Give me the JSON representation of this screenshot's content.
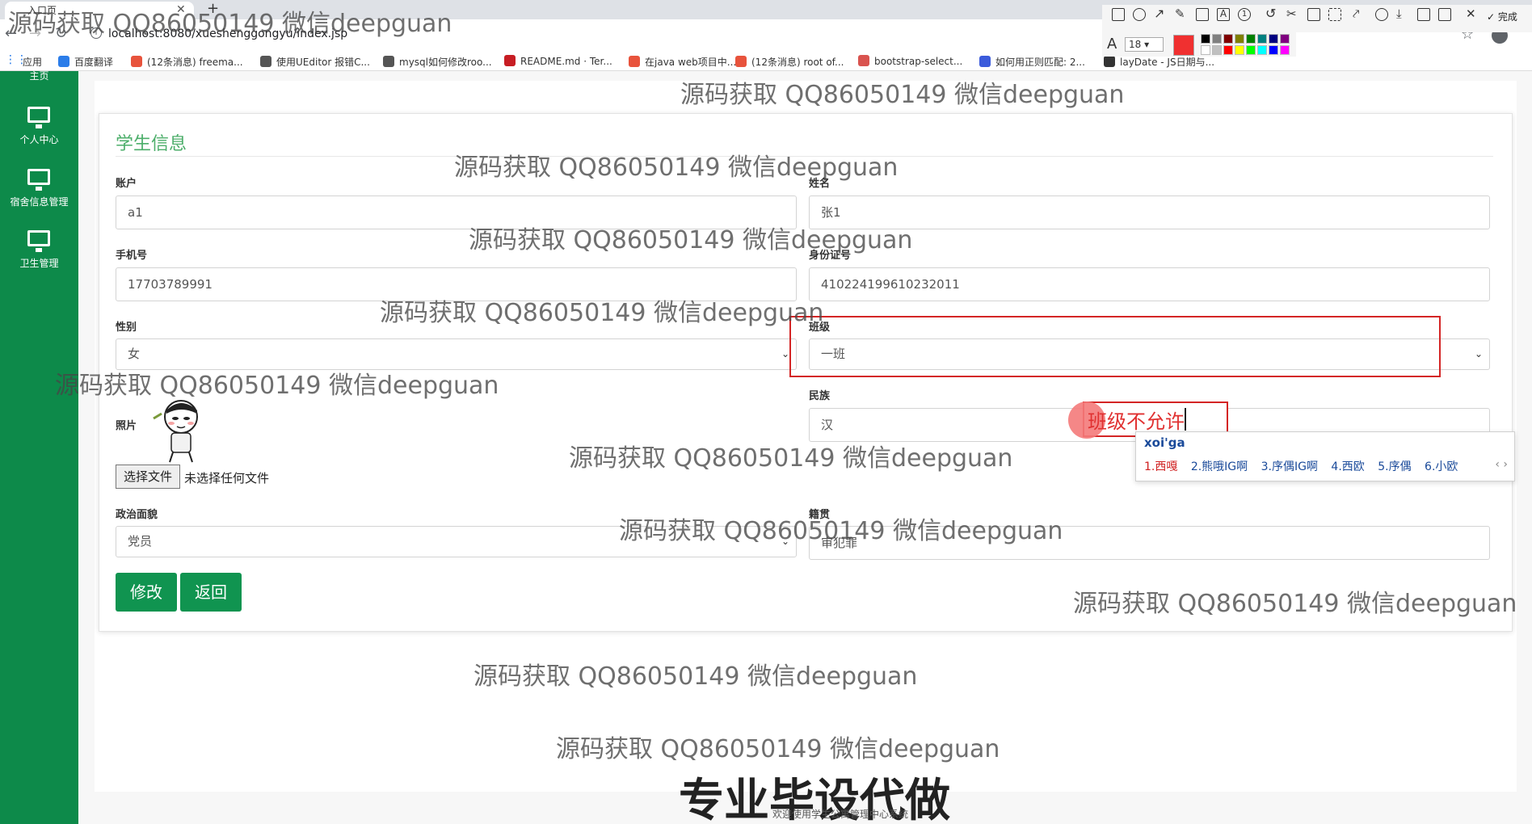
{
  "browser": {
    "tab_title": "入口页",
    "url": "localhost:8080/xueshenggongyu/index.jsp",
    "apps_label": "应用",
    "bookmarks": [
      {
        "label": "百度翻译",
        "color": "#2b7de9"
      },
      {
        "label": "(12条消息) freema...",
        "color": "#e8533c"
      },
      {
        "label": "使用UEditor 报错C...",
        "color": "#555555"
      },
      {
        "label": "mysql如何修改roo...",
        "color": "#555555"
      },
      {
        "label": "README.md · Ter...",
        "color": "#c71d23"
      },
      {
        "label": "在java web项目中...",
        "color": "#e8533c"
      },
      {
        "label": "(12条消息) root of...",
        "color": "#e8533c"
      },
      {
        "label": "bootstrap-select...",
        "color": "#d9534f"
      },
      {
        "label": "如何用正则匹配: 2...",
        "color": "#3b5bdb"
      },
      {
        "label": "layDate - JS日期与...",
        "color": "#333333"
      }
    ]
  },
  "snip_toolbar": {
    "font_size": "18",
    "done_label": "完成",
    "current_color": "#f03030",
    "swatches": [
      "#000000",
      "#808080",
      "#800000",
      "#808000",
      "#008000",
      "#008080",
      "#000080",
      "#800080",
      "#ffffff",
      "#c0c0c0",
      "#ff0000",
      "#ffff00",
      "#00ff00",
      "#00ffff",
      "#0000ff",
      "#ff00ff"
    ]
  },
  "sidebar": {
    "top_label": "主页",
    "items": [
      {
        "label": "个人中心"
      },
      {
        "label": "宿舍信息管理"
      },
      {
        "label": "卫生管理"
      }
    ]
  },
  "form": {
    "title": "学生信息",
    "account": {
      "label": "账户",
      "value": "a1"
    },
    "name": {
      "label": "姓名",
      "value": "张1"
    },
    "phone": {
      "label": "手机号",
      "value": "17703789991"
    },
    "id_card": {
      "label": "身份证号",
      "value": "410224199610232011"
    },
    "gender": {
      "label": "性别",
      "value": "女"
    },
    "class": {
      "label": "班级",
      "value": "一班"
    },
    "ethnicity": {
      "label": "民族",
      "value": "汉"
    },
    "photo": {
      "label": "照片",
      "button": "选择文件",
      "status": "未选择任何文件"
    },
    "political": {
      "label": "政治面貌",
      "value": "党员"
    },
    "origin": {
      "label": "籍贯",
      "value": "审犯罪"
    },
    "modify_button": "修改",
    "back_button": "返回"
  },
  "annotation": {
    "text": "班级不允许"
  },
  "ime": {
    "input": "xoi'ga",
    "candidates": [
      "1.西嘎",
      "2.熊哦IG啊",
      "3.序偶IG啊",
      "4.西欧",
      "5.序偶",
      "6.小欧"
    ]
  },
  "watermark": "源码获取 QQ86050149 微信deepguan",
  "big_watermark": "专业毕设代做",
  "footer": "欢迎使用学生公寓管理中心系统"
}
